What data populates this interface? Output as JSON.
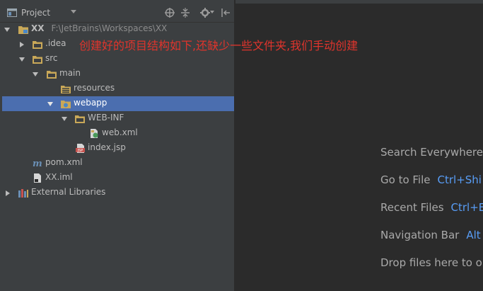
{
  "toolbar": {
    "view_label": "Project"
  },
  "tree": {
    "root": {
      "label": "XX",
      "path": "F:\\JetBrains\\Workspaces\\XX"
    },
    "idea": {
      "label": ".idea"
    },
    "src": {
      "label": "src"
    },
    "main": {
      "label": "main"
    },
    "resources": {
      "label": "resources"
    },
    "webapp": {
      "label": "webapp"
    },
    "webinf": {
      "label": "WEB-INF"
    },
    "webxml": {
      "label": "web.xml"
    },
    "indexjsp": {
      "label": "index.jsp"
    },
    "pom": {
      "label": "pom.xml"
    },
    "iml": {
      "label": "XX.iml"
    },
    "extlibs": {
      "label": "External Libraries"
    }
  },
  "annotation": "创建好的项目结构如下,还缺少一些文件夹,我们手动创建",
  "editor": {
    "hints": [
      {
        "label": "Search Everywhere",
        "key": ""
      },
      {
        "label": "Go to File",
        "key": "Ctrl+Shi"
      },
      {
        "label": "Recent Files",
        "key": "Ctrl+E"
      },
      {
        "label": "Navigation Bar",
        "key": "Alt"
      },
      {
        "label": "Drop files here to o",
        "key": ""
      }
    ]
  },
  "colors": {
    "panel_bg": "#3c3f41",
    "editor_bg": "#2b2b2b",
    "selection": "#4b6eaf",
    "annotation": "#e0342c",
    "shortcut": "#589df6",
    "folder": "#c9a858"
  }
}
